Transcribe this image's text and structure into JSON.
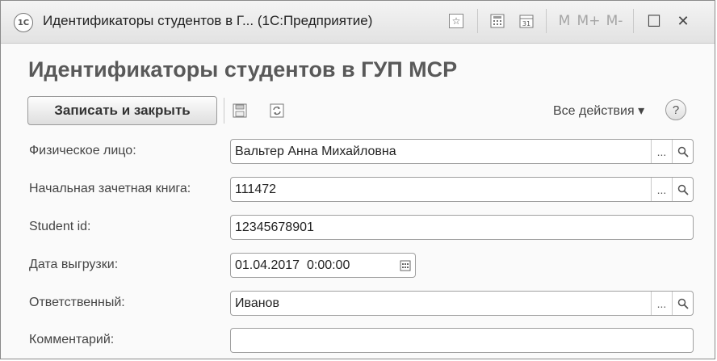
{
  "window": {
    "logo": "1С",
    "title": "Идентификаторы студентов в Г...  (1С:Предприятие)",
    "toolbar": {
      "m": "M",
      "m_plus": "M+",
      "m_minus": "M-",
      "maximize": "☐",
      "close": "✕"
    }
  },
  "form": {
    "title": "Идентификаторы студентов в ГУП МСР",
    "save_close_label": "Записать и закрыть",
    "all_actions_label": "Все действия ▾",
    "help_label": "?",
    "fields": {
      "person": {
        "label": "Физическое лицо:",
        "value": "Вальтер Анна Михайловна"
      },
      "record_book": {
        "label": "Начальная зачетная книга:",
        "value": "111472"
      },
      "student_id": {
        "label": "Student id:",
        "value": "12345678901"
      },
      "export_date": {
        "label": "Дата выгрузки:",
        "value": "01.04.2017  0:00:00"
      },
      "responsible": {
        "label": "Ответственный:",
        "value": "Иванов"
      },
      "comment": {
        "label": "Комментарий:",
        "value": ""
      }
    },
    "select_button": "...",
    "search_icon_name": "search-icon"
  }
}
